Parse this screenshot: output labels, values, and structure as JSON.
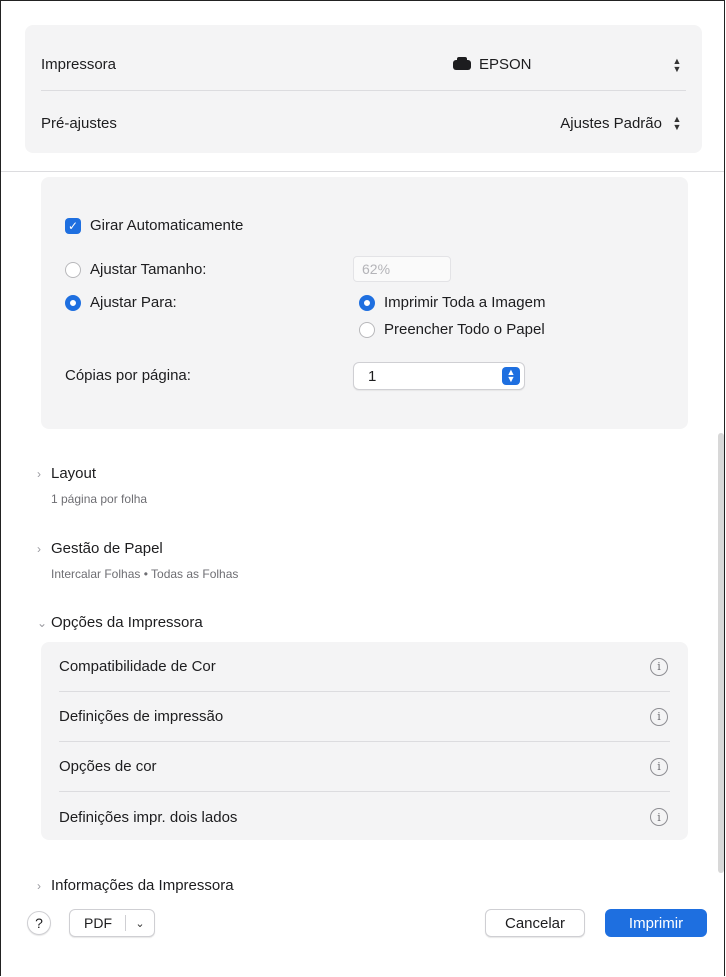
{
  "header": {
    "printer_label": "Impressora",
    "printer_value": "EPSON",
    "printer_icon": "printer-icon",
    "presets_label": "Pré-ajustes",
    "presets_value": "Ajustes Padrão"
  },
  "scale": {
    "auto_rotate_label": "Girar Automaticamente",
    "auto_rotate_checked": true,
    "scale_label": "Ajustar Tamanho:",
    "scale_value": "62%",
    "fit_label": "Ajustar Para:",
    "fit_option_1": "Imprimir Toda a Imagem",
    "fit_option_2": "Preencher Todo o Papel",
    "copies_per_page_label": "Cópias por página:",
    "copies_per_page_value": "1"
  },
  "sections": {
    "layout_title": "Layout",
    "layout_sub": "1 página por folha",
    "paper_title": "Gestão de Papel",
    "paper_sub": "Intercalar Folhas • Todas as Folhas",
    "options_title": "Opções da Impressora",
    "options_items": [
      "Compatibilidade de Cor",
      "Definições de impressão",
      "Opções de cor",
      "Definições impr. dois lados"
    ],
    "info_title": "Informações da Impressora"
  },
  "footer": {
    "help_label": "?",
    "pdf_label": "PDF",
    "cancel_label": "Cancelar",
    "print_label": "Imprimir"
  },
  "colors": {
    "accent": "#1e6fe0",
    "panel": "#f4f4f5"
  }
}
